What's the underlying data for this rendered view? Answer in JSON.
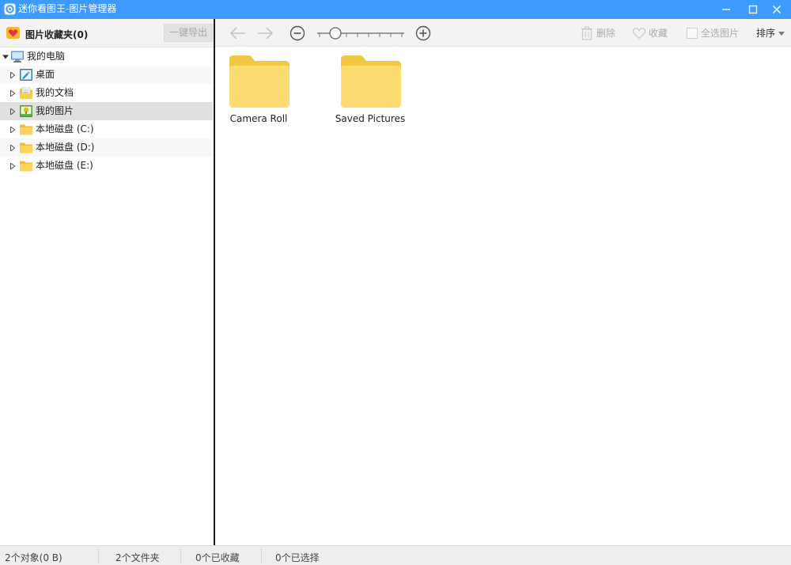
{
  "window": {
    "title": "迷你看图王-图片管理器",
    "accent": "#3d9bff"
  },
  "favorites": {
    "title": "图片收藏夹(0)",
    "export_label": "一键导出"
  },
  "tree": {
    "root": {
      "label": "我的电脑",
      "icon": "computer-icon"
    },
    "items": [
      {
        "label": "桌面",
        "icon": "desktop-icon"
      },
      {
        "label": "我的文档",
        "icon": "documents-icon"
      },
      {
        "label": "我的图片",
        "icon": "pictures-icon",
        "selected": true
      },
      {
        "label": "本地磁盘 (C:)",
        "icon": "folder-icon"
      },
      {
        "label": "本地磁盘 (D:)",
        "icon": "folder-icon"
      },
      {
        "label": "本地磁盘 (E:)",
        "icon": "folder-icon"
      }
    ]
  },
  "toolbar": {
    "delete_label": "删除",
    "favorite_label": "收藏",
    "select_all_label": "全选图片",
    "sort_label": "排序"
  },
  "folders": [
    {
      "name": "Camera Roll"
    },
    {
      "name": "Saved Pictures"
    }
  ],
  "status": {
    "objects": "2个对象(0 B)",
    "folders": "2个文件夹",
    "favorited": "0个已收藏",
    "selected": "0个已选择"
  }
}
